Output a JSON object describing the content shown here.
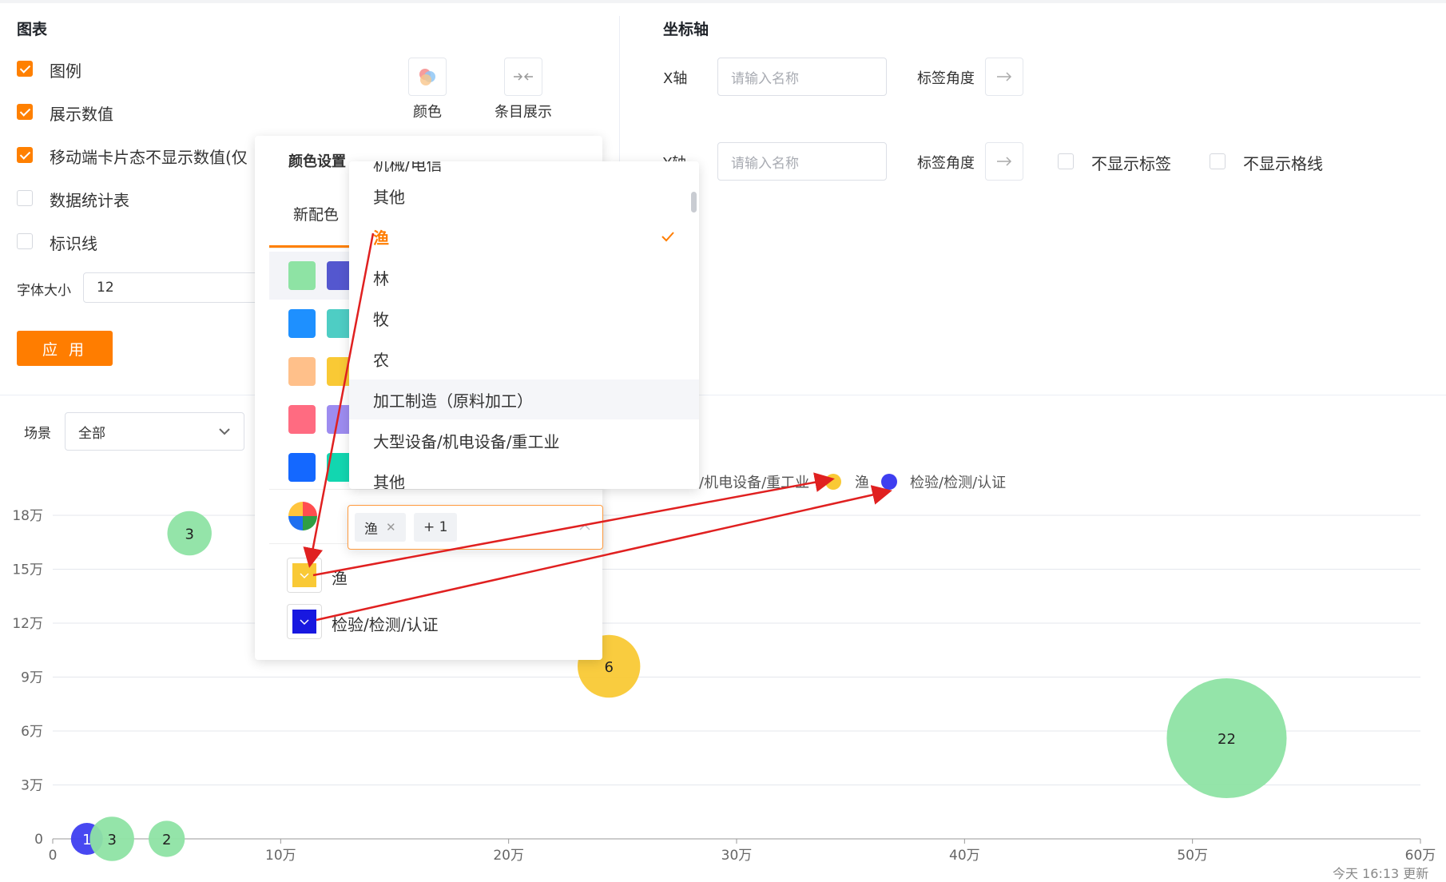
{
  "colors": {
    "accent": "#ff8000",
    "bubble_green": "#8ee3a4",
    "bubble_yellow": "#f9c935",
    "bubble_blue": "#3e3ef0",
    "arrow_red": "#e02020"
  },
  "chart_settings": {
    "title": "图表",
    "checkboxes": [
      {
        "label": "图例",
        "checked": true
      },
      {
        "label": "展示数值",
        "checked": true
      },
      {
        "label": "移动端卡片态不显示数值(仅",
        "checked": true
      },
      {
        "label": "数据统计表",
        "checked": false
      },
      {
        "label": "标识线",
        "checked": false
      }
    ],
    "font_size_label": "字体大小",
    "font_size_value": "12",
    "apply_label": "应 用",
    "color_button_label": "颜色",
    "item_display_label": "条目展示"
  },
  "axis_settings": {
    "title": "坐标轴",
    "x_label": "X轴",
    "x_placeholder": "请输入名称",
    "y_label": "Y轴",
    "y_placeholder": "请输入名称",
    "label_angle": "标签角度",
    "hide_labels": "不显示标签",
    "hide_gridlines": "不显示格线"
  },
  "color_panel": {
    "title": "颜色设置",
    "tab_label": "新配色",
    "palette_icon": "palette-icon",
    "series": [
      {
        "label": "渔",
        "color": "#f9c935"
      },
      {
        "label": "检验/检测/认证",
        "color": "#1818e0"
      }
    ]
  },
  "dropdown": {
    "partial_top": "机械/电信",
    "items": [
      {
        "label": "其他",
        "selected": false
      },
      {
        "label": "渔",
        "selected": true
      },
      {
        "label": "林",
        "selected": false
      },
      {
        "label": "牧",
        "selected": false
      },
      {
        "label": "农",
        "selected": false
      },
      {
        "label": "加工制造（原料加工）",
        "selected": false
      },
      {
        "label": "大型设备/机电设备/重工业",
        "selected": false
      },
      {
        "label": "其他",
        "selected": false
      }
    ],
    "tag_label": "渔",
    "tag_more": "+ 1"
  },
  "filter": {
    "label": "场景",
    "value": "全部"
  },
  "legend": [
    {
      "label": "/机电设备/重工业",
      "color": "",
      "shows_marker": false
    },
    {
      "label": "渔",
      "color": "#f9c935"
    },
    {
      "label": "检验/检测/认证",
      "color": "#3e3ef0"
    }
  ],
  "update_note": "今天 16:13 更新",
  "chart_data": {
    "type": "scatter",
    "x_ticks": [
      "0",
      "10万",
      "20万",
      "30万",
      "40万",
      "50万",
      "60万"
    ],
    "y_ticks": [
      "0",
      "3万",
      "6万",
      "9万",
      "12万",
      "15万",
      "18万"
    ],
    "xlim": [
      0,
      600000
    ],
    "ylim": [
      0,
      180000
    ],
    "grid": true,
    "points": [
      {
        "x": 60000,
        "y": 170000,
        "size": 3,
        "label": "3",
        "color": "#8ee3a4"
      },
      {
        "x": 15000,
        "y": 0,
        "size": 1,
        "label": "1",
        "color": "#3e3ef0"
      },
      {
        "x": 26000,
        "y": 0,
        "size": 3,
        "label": "3",
        "color": "#8ee3a4"
      },
      {
        "x": 50000,
        "y": 0,
        "size": 2,
        "label": "2",
        "color": "#8ee3a4"
      },
      {
        "x": 244000,
        "y": 96000,
        "size": 6,
        "label": "6",
        "color": "#f9c935"
      },
      {
        "x": 515000,
        "y": 56000,
        "size": 22,
        "label": "22",
        "color": "#8ee3a4"
      }
    ]
  }
}
